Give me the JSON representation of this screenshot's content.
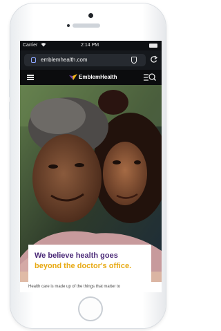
{
  "status_bar": {
    "carrier": "Carrier",
    "time": "2:14 PM"
  },
  "browser": {
    "url": "emblemhealth.com",
    "reload_icon": "reload-icon",
    "shield_icon": "shield-icon",
    "lock_icon": "lock-icon"
  },
  "site_nav": {
    "logo_text": "EmblemHealth",
    "menu_icon": "hamburger-menu-icon",
    "search_icon": "search-menu-icon"
  },
  "hero": {
    "heading_line1": "We believe health goes",
    "heading_line2": "beyond the doctor's office.",
    "body": "Health care is made up of the things that matter to"
  },
  "colors": {
    "brand_purple": "#4b2a78",
    "brand_gold": "#e7a913",
    "logo_yellow": "#f2b718",
    "logo_purple": "#6b3fa0"
  }
}
